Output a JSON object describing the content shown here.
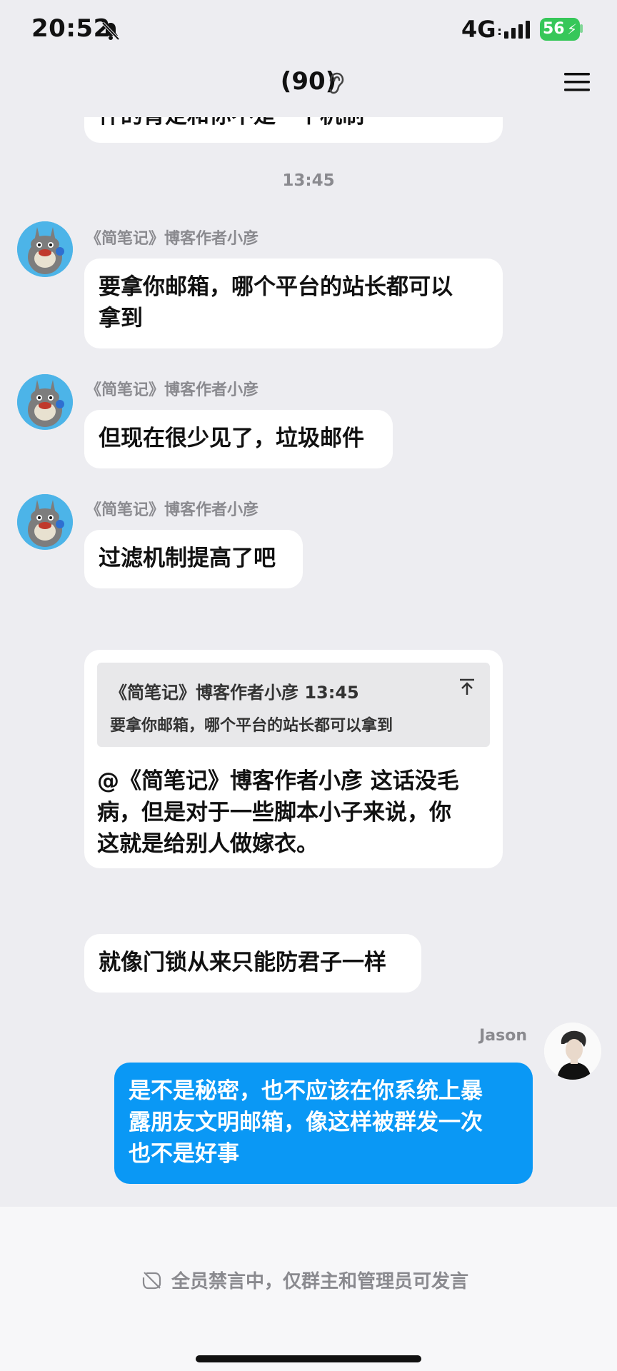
{
  "status_bar": {
    "time": "20:52",
    "network": "4G",
    "battery": "56",
    "battery_color": "#36c759"
  },
  "header": {
    "title": "(90)",
    "ear_icon": "ear-icon",
    "menu_icon": "hamburger-menu-icon"
  },
  "chat": {
    "partial_top_text": "件的肯定和你不是一个机制",
    "timestamp": "13:45",
    "messages": [
      {
        "sender": "《简笔记》博客作者小彦",
        "text_line1": "要拿你邮箱，哪个平台的站长都可以",
        "text_line2": "拿到"
      },
      {
        "sender": "《简笔记》博客作者小彦",
        "text": "但现在很少见了，垃圾邮件"
      },
      {
        "sender": "《简笔记》博客作者小彦",
        "text": "过滤机制提高了吧"
      }
    ],
    "quote": {
      "header": "《简笔记》博客作者小彦 13:45",
      "quoted_text": "要拿你邮箱，哪个平台的站长都可以拿到",
      "reply_line1": "@《简笔记》博客作者小彦 这话没毛",
      "reply_line2": "病，但是对于一些脚本小子来说，你",
      "reply_line3": "这就是给别人做嫁衣。"
    },
    "follow_up": "就像门锁从来只能防君子一样",
    "me": {
      "name": "Jason",
      "line1": "是不是秘密，也不应该在你系统上暴",
      "line2": "露朋友文明邮箱，像这样被群发一次",
      "line3": "也不是好事",
      "bubble_color": "#0a98f5"
    }
  },
  "bottom": {
    "mute_notice": "全员禁言中，仅群主和管理员可发言"
  }
}
